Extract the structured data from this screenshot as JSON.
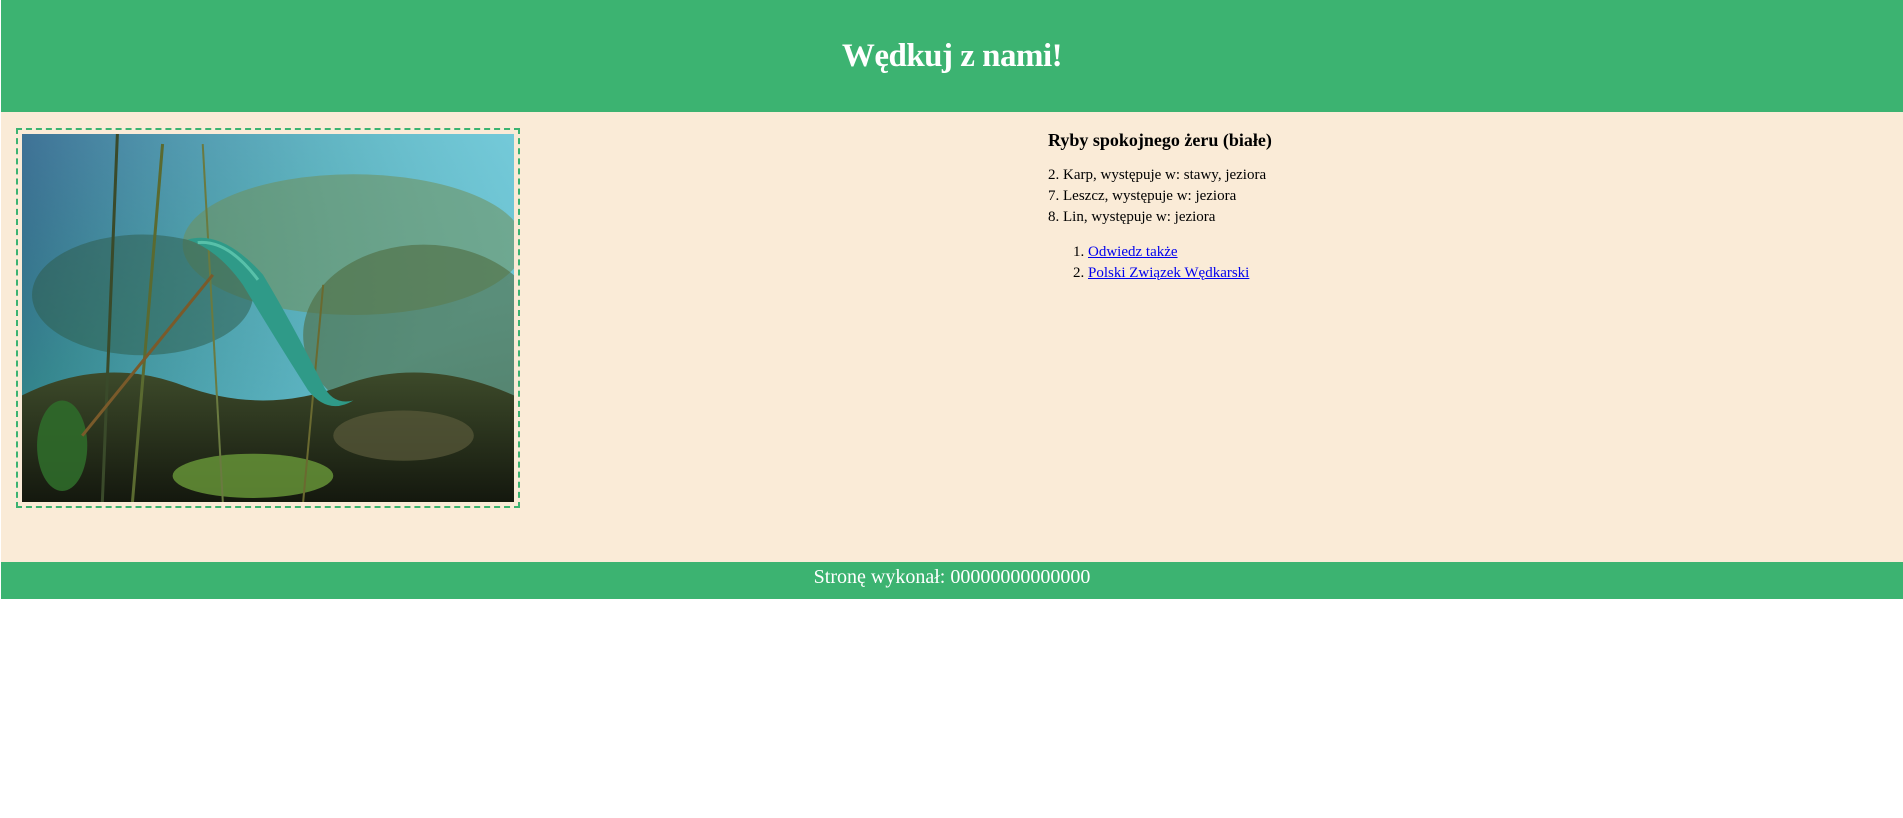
{
  "header": {
    "title": "Wędkuj z nami!"
  },
  "main": {
    "photo_alt": "",
    "section_title": "Ryby spokojnego żeru (białe)",
    "fish": [
      "2. Karp, występuje w: stawy, jeziora",
      "7. Leszcz, występuje w: jeziora",
      "8. Lin, występuje w: jeziora"
    ],
    "links": [
      "Odwiedz także",
      "Polski Związek Wędkarski"
    ]
  },
  "footer": {
    "text": "Stronę wykonał: 00000000000000"
  },
  "colors": {
    "accent": "#3cb371",
    "background": "#faebd7",
    "link": "#0000ee"
  }
}
